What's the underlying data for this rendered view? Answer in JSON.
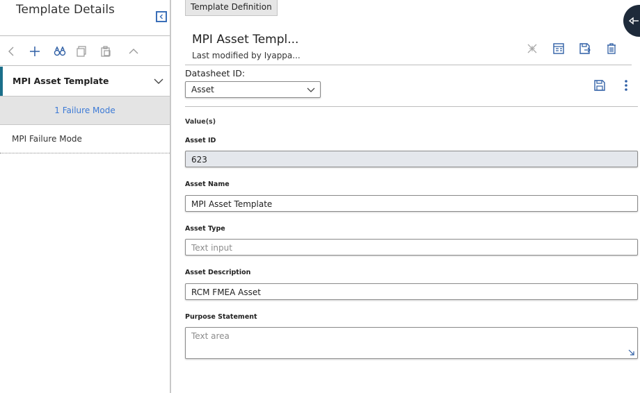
{
  "left_panel": {
    "title": "Template Details",
    "tree_item": "MPI Asset Template",
    "group_header": "1 Failure Mode",
    "list_items": [
      "MPI Failure Mode"
    ]
  },
  "right_panel": {
    "tab_label": "Template Definition",
    "record_title": "MPI Asset Templ...",
    "record_subtitle": "Last modified by Iyappa...",
    "datasheet_label": "Datasheet ID:",
    "datasheet_value": "Asset",
    "values_label": "Value(s)",
    "fields": {
      "asset_id": {
        "label": "Asset ID",
        "value": "623"
      },
      "asset_name": {
        "label": "Asset Name",
        "value": "MPI Asset Template"
      },
      "asset_type": {
        "label": "Asset Type",
        "placeholder": "Text input"
      },
      "asset_description": {
        "label": "Asset Description",
        "value": "RCM FMEA Asset"
      },
      "purpose_statement": {
        "label": "Purpose Statement",
        "placeholder": "Text area"
      }
    }
  },
  "colors": {
    "accent_blue": "#3d7ad6",
    "icon_blue": "#2f5fa5",
    "tree_marker": "#1b6f8a",
    "float_button": "#1e2a3a"
  }
}
